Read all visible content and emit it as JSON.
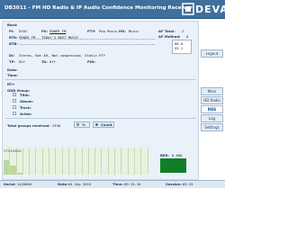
{
  "header": {
    "title": "DB3011 - FM HD Radio & IP Audio Confidence Monitoring Receiver",
    "logo_text": "DEVA"
  },
  "nav": {
    "logout": "Logout",
    "items": [
      "Main",
      "HD Radio",
      "RDS",
      "Log",
      "Settings"
    ]
  },
  "rds": {
    "section_label": "Basic",
    "pi_label": "PI:",
    "pi_value": "0101",
    "ps_label": "PS:",
    "ps_value": "POWER FM",
    "pty_label": "PTY:",
    "pty_value": "Pop Music",
    "ms_label": "MS:",
    "ms_value": "Music",
    "af_total_label": "AF Total:",
    "af_total_value": "2",
    "af_method_label": "AF Method:",
    "af_method_value": "A",
    "rta_label": "RTA:",
    "rta_value": "POWER FM - TODAY'S BEST MUSIC",
    "rtb_label": "RTB:",
    "rtb_value": "",
    "af_list": [
      "88.0",
      "95.1"
    ],
    "di_label": "DI:",
    "di_value": "Stereo, Not AH, Not compressed, Static PTY",
    "tp_label": "TP:",
    "tp_value": "Off",
    "ta_label": "TA:",
    "ta_value": "Off",
    "pin_label": "PIN:",
    "pin_value": "",
    "date_label": "Date:",
    "time_label": "Time:"
  },
  "rtplus": {
    "label": "RT+",
    "odr_label": "ODR Group:",
    "fields": [
      "Title:",
      "Album:",
      "Track:",
      "Artist:"
    ]
  },
  "groups": {
    "total_label": "Total groups received:",
    "total_value": "2330",
    "pct_btn": "%",
    "count_btn": "Count",
    "ber_label": "BER:",
    "ber_value": "0.000",
    "bar_values": [
      "17%",
      "10%",
      "2%",
      "",
      "",
      "",
      "",
      "",
      "",
      "",
      "",
      "",
      "",
      "",
      "",
      "",
      "",
      "",
      "",
      "",
      "",
      ""
    ],
    "bar_levels": [
      0.55,
      0.35,
      0.08,
      0,
      0,
      0,
      0,
      0,
      0,
      0,
      0,
      0,
      0,
      0,
      0,
      0,
      0,
      0,
      0,
      0,
      0,
      0
    ]
  },
  "status": {
    "serial_label": "Serial:",
    "serial_value": "1420000",
    "date_label": "Date:",
    "date_value": "04 Sep 2015",
    "time_label": "Time:",
    "time_value": "09:15:10",
    "session_label": "Session:",
    "session_value": "02:33"
  },
  "colors": {
    "header": "#3f6f9d",
    "panel": "#eaf1f8",
    "ber_ok": "#0f7f2a"
  }
}
